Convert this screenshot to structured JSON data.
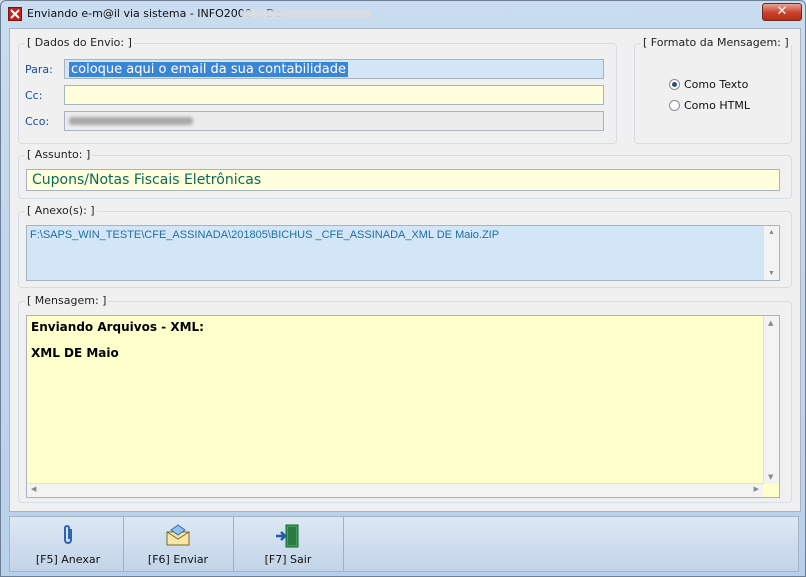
{
  "window": {
    "title": "Enviando e-m@il via sistema - INFO2000 :: De:",
    "close_label": "✕"
  },
  "envio": {
    "group_label": "[ Dados do Envio: ]",
    "para_label": "Para:",
    "para_value": "coloque aqui o email da sua contabilidade",
    "cc_label": "Cc:",
    "cc_value": "",
    "cco_label": "Cco:"
  },
  "formato": {
    "group_label": "[ Formato da Mensagem: ]",
    "options": [
      {
        "label": "Como Texto",
        "selected": true
      },
      {
        "label": "Como HTML",
        "selected": false
      }
    ]
  },
  "assunto": {
    "group_label": "[ Assunto: ]",
    "value": "Cupons/Notas Fiscais Eletrônicas"
  },
  "anexo": {
    "group_label": "[ Anexo(s): ]",
    "value": "F:\\SAPS_WIN_TESTE\\CFE_ASSINADA\\201805\\BICHUS _CFE_ASSINADA_XML DE Maio.ZIP"
  },
  "mensagem": {
    "group_label": "[ Mensagem: ]",
    "lines": [
      "Enviando Arquivos - XML:",
      "XML DE Maio"
    ]
  },
  "toolbar": {
    "anexar_label": "[F5] Anexar",
    "enviar_label": "[F6] Enviar",
    "sair_label": "[F7] Sair"
  }
}
